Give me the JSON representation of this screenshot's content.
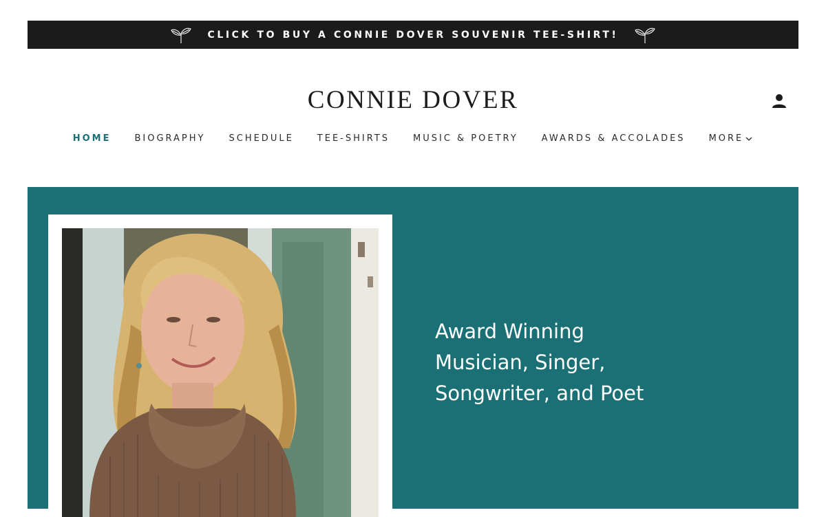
{
  "announcement": {
    "text": "CLICK TO BUY A CONNIE DOVER SOUVENIR TEE-SHIRT!",
    "left_icon": "sprout-icon",
    "right_icon": "sprout-icon"
  },
  "header": {
    "site_title": "CONNIE DOVER",
    "account_icon": "person-icon"
  },
  "nav": {
    "items": [
      {
        "label": "HOME",
        "active": true
      },
      {
        "label": "BIOGRAPHY"
      },
      {
        "label": "SCHEDULE"
      },
      {
        "label": "TEE-SHIRTS"
      },
      {
        "label": "MUSIC & POETRY"
      },
      {
        "label": "AWARDS & ACCOLADES"
      },
      {
        "label": "MORE",
        "icon": "chevron-down-icon"
      }
    ]
  },
  "hero": {
    "tagline_lines": [
      "Award Winning",
      "Musician, Singer,",
      "Songwriter, and Poet"
    ]
  },
  "colors": {
    "announcement_bg": "#1b1b1b",
    "hero_bg": "#1b7075",
    "nav_active": "#1a7075",
    "text_dark": "#1b1b1b"
  }
}
